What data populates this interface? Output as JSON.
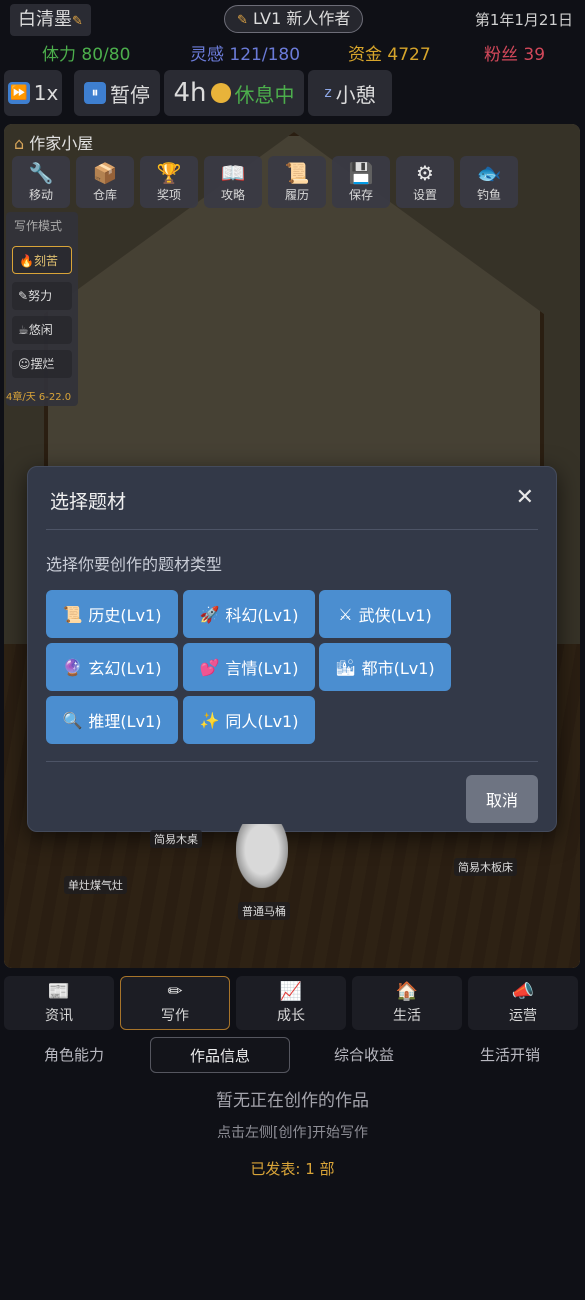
{
  "header": {
    "player_name": "白清墨",
    "level_badge": "LV1 新人作者",
    "date": "第1年1月21日"
  },
  "stats": {
    "stamina": "体力 80/80",
    "inspiration": "灵感 121/180",
    "money": "资金 4727",
    "fans": "粉丝 39"
  },
  "controls": {
    "speed": "1x",
    "pause": "暂停",
    "rest_hours": "4h",
    "rest_state": "休息中",
    "nap": "小憩"
  },
  "house": {
    "title": "作家小屋",
    "tools": [
      {
        "icon": "wrench-icon",
        "glyph": "🔧",
        "label": "移动"
      },
      {
        "icon": "box-icon",
        "glyph": "📦",
        "label": "仓库"
      },
      {
        "icon": "trophy-icon",
        "glyph": "🏆",
        "label": "奖项"
      },
      {
        "icon": "book-icon",
        "glyph": "📖",
        "label": "攻略"
      },
      {
        "icon": "scroll-icon",
        "glyph": "📜",
        "label": "履历"
      },
      {
        "icon": "save-icon",
        "glyph": "💾",
        "label": "保存"
      },
      {
        "icon": "gear-icon",
        "glyph": "⚙",
        "label": "设置"
      },
      {
        "icon": "fish-icon",
        "glyph": "🐟",
        "label": "钓鱼"
      }
    ],
    "writing_mode": {
      "title": "写作模式",
      "options": [
        "刻苦",
        "努力",
        "悠闲",
        "摆烂"
      ],
      "selected": "刻苦",
      "rate": "4章/天 6-22.0"
    },
    "furniture_labels": {
      "stove": "单灶煤气灶",
      "toilet": "普通马桶",
      "bed": "简易木板床",
      "table": "简易木桌"
    }
  },
  "modal": {
    "title": "选择题材",
    "subtitle": "选择你要创作的题材类型",
    "genres": [
      {
        "icon": "scroll-icon",
        "glyph": "📜",
        "label": "历史(Lv1)"
      },
      {
        "icon": "rocket-icon",
        "glyph": "🚀",
        "label": "科幻(Lv1)"
      },
      {
        "icon": "swords-icon",
        "glyph": "⚔",
        "label": "武侠(Lv1)"
      },
      {
        "icon": "crystal-ball-icon",
        "glyph": "🔮",
        "label": "玄幻(Lv1)"
      },
      {
        "icon": "hearts-icon",
        "glyph": "💕",
        "label": "言情(Lv1)"
      },
      {
        "icon": "city-icon",
        "glyph": "🏙",
        "label": "都市(Lv1)"
      },
      {
        "icon": "magnifier-icon",
        "glyph": "🔍",
        "label": "推理(Lv1)"
      },
      {
        "icon": "sparkles-icon",
        "glyph": "✨",
        "label": "同人(Lv1)"
      }
    ],
    "cancel": "取消"
  },
  "nav": [
    {
      "icon": "news-icon",
      "glyph": "📰",
      "label": "资讯"
    },
    {
      "icon": "pencil-icon",
      "glyph": "✏",
      "label": "写作"
    },
    {
      "icon": "chart-icon",
      "glyph": "📈",
      "label": "成长"
    },
    {
      "icon": "house-icon",
      "glyph": "🏠",
      "label": "生活"
    },
    {
      "icon": "megaphone-icon",
      "glyph": "📣",
      "label": "运营"
    }
  ],
  "nav_active": "写作",
  "subtabs": [
    "角色能力",
    "作品信息",
    "综合收益",
    "生活开销"
  ],
  "subtab_active": "作品信息",
  "works": {
    "empty": "暂无正在创作的作品",
    "hint": "点击左侧[创作]开始写作",
    "published": "已发表: 1 部"
  },
  "colors": {
    "genre_button": "#4b8ed0",
    "cancel_button": "#6e7482",
    "modal_bg": "#333948",
    "accent_gold": "#d9a438",
    "stamina": "#4cae4c",
    "inspiration": "#6b7bd8",
    "fans": "#d2485a"
  }
}
